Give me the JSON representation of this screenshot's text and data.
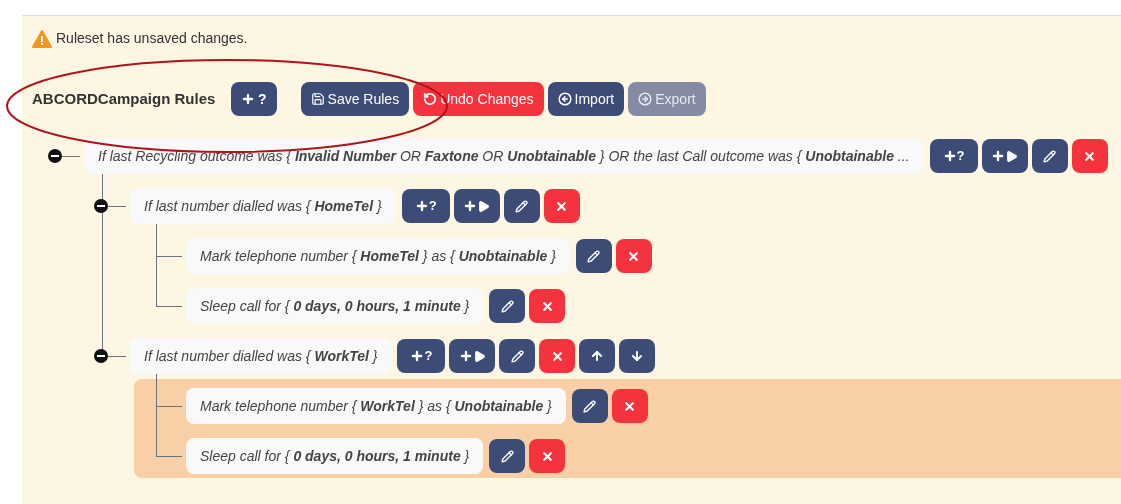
{
  "notice": {
    "text": "Ruleset has unsaved changes."
  },
  "toolbar": {
    "title": "ABCORDCampaign Rules",
    "buttons": [
      {
        "kind": "add_condition",
        "label": "?",
        "disabled": false
      },
      {
        "kind": "save",
        "label": "Save Rules",
        "disabled": false
      },
      {
        "kind": "undo",
        "label": "Undo Changes",
        "disabled": false
      },
      {
        "kind": "import",
        "label": "Import",
        "disabled": false
      },
      {
        "kind": "export",
        "label": "Export",
        "disabled": true
      }
    ]
  },
  "annotation": {
    "kind": "ellipse"
  },
  "rules": [
    {
      "kind": "condition",
      "text": "If last Recycling outcome was { **Invalid Number** OR **Faxtone** OR **Unobtainable** } OR the last Call outcome was { **Unobtainable** ...",
      "expanded": true,
      "highlighted": false,
      "actions": [
        {
          "kind": "add_condition",
          "label": "?"
        },
        {
          "kind": "add_action"
        },
        {
          "kind": "edit"
        },
        {
          "kind": "delete"
        }
      ],
      "children": [
        {
          "kind": "condition",
          "text": "If last number dialled was { **HomeTel** }",
          "expanded": true,
          "highlighted": false,
          "actions": [
            {
              "kind": "add_condition",
              "label": "?"
            },
            {
              "kind": "add_action"
            },
            {
              "kind": "edit"
            },
            {
              "kind": "delete"
            }
          ],
          "children": [
            {
              "kind": "action",
              "text": "Mark telephone number { **HomeTel** } as { **Unobtainable** }",
              "actions": [
                {
                  "kind": "edit"
                },
                {
                  "kind": "delete"
                }
              ]
            },
            {
              "kind": "action",
              "text": "Sleep call for { **0 days, 0 hours, 1 minute** }",
              "actions": [
                {
                  "kind": "edit"
                },
                {
                  "kind": "delete"
                }
              ]
            }
          ]
        },
        {
          "kind": "condition",
          "text": "If last number dialled was { **WorkTel** }",
          "expanded": true,
          "highlighted": true,
          "actions": [
            {
              "kind": "add_condition",
              "label": "?"
            },
            {
              "kind": "add_action"
            },
            {
              "kind": "edit"
            },
            {
              "kind": "delete"
            },
            {
              "kind": "move_up"
            },
            {
              "kind": "move_down"
            }
          ],
          "children": [
            {
              "kind": "action",
              "text": "Mark telephone number { **WorkTel** } as { **Unobtainable** }",
              "actions": [
                {
                  "kind": "edit"
                },
                {
                  "kind": "delete"
                }
              ]
            },
            {
              "kind": "action",
              "text": "Sleep call for { **0 days, 0 hours, 1 minute** }",
              "actions": [
                {
                  "kind": "edit"
                },
                {
                  "kind": "delete"
                }
              ]
            }
          ]
        }
      ]
    }
  ]
}
